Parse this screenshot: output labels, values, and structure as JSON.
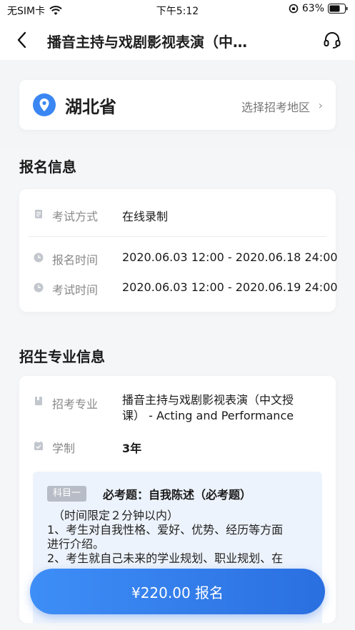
{
  "status": {
    "carrier": "无SIM卡",
    "time": "下午5:12",
    "battery": "63%"
  },
  "nav": {
    "title": "播音主持与戏剧影视表演（中…"
  },
  "region": {
    "name": "湖北省",
    "select_label": "选择招考地区",
    "chevron": "›"
  },
  "registration": {
    "title": "报名信息",
    "rows": [
      {
        "label": "考试方式",
        "value": "在线录制"
      },
      {
        "label": "报名时间",
        "value": "2020.06.03 12:00 - 2020.06.18 24:00"
      },
      {
        "label": "考试时间",
        "value": "2020.06.03 12:00 - 2020.06.19 24:00"
      }
    ]
  },
  "major": {
    "title": "招生专业信息",
    "major_label": "招考专业",
    "major_value_line1": "播音主持与戏剧影视表演（中文授",
    "major_value_line2": "课） - Acting and Performance",
    "duration_label": "学制",
    "duration_value": "3年",
    "subject": {
      "tag": "科目一",
      "title": "必考题：自我陈述（必考题）",
      "lines": [
        "（时间限定２分钟以内）",
        "1、考生对自我性格、爱好、优势、经历等方面",
        "进行介绍。",
        "2、考生就自己未来的学业规划、职业规划、在"
      ]
    }
  },
  "cta": {
    "label": "¥220.00 报名"
  },
  "colors": {
    "accent": "#3a86f2",
    "subject_bg": "#edf3fc"
  }
}
